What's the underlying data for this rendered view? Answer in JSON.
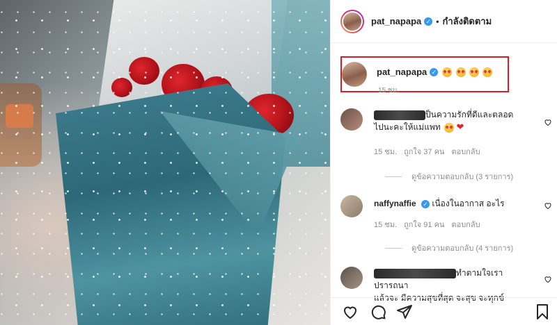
{
  "post": {
    "username": "pat_napapa",
    "separator": "•",
    "follow_status": "กำลังติดตาม",
    "caption": {
      "username": "pat_napapa",
      "emoji": [
        "star-struck-emoji",
        "star-struck-emoji",
        "star-struck-emoji",
        "star-struck-emoji"
      ],
      "time": "15 ชม."
    }
  },
  "comments": [
    {
      "username": "",
      "text_line1": "ป็นความรักที่ดีและตลอด",
      "text_line2": "ไปนะคะให้แม่แพท",
      "time": "15 ชม.",
      "likes": "ถูกใจ 37 คน",
      "reply": "ตอบกลับ",
      "view_replies": "ดูข้อความตอบกลับ (3 รายการ)"
    },
    {
      "username": "naffynaffie",
      "text_line1": "เนื่องในอากาส อะไร",
      "time": "15 ชม.",
      "likes": "ถูกใจ 91 คน",
      "reply": "ตอบกลับ",
      "view_replies": "ดูข้อความตอบกลับ (4 รายการ)"
    },
    {
      "username": "",
      "text_line1": "ทำตามใจเราปรารถนา",
      "text_line2": "แล้วจะ มีความสุขที่สุด จะสุข จะทุกข์"
    }
  ],
  "icons": {
    "verified": "✓",
    "heart_emoji": "❤"
  },
  "colors": {
    "highlight_box": "#e21b23",
    "verified": "#3897f0",
    "muted_text": "#8e8e8e"
  }
}
